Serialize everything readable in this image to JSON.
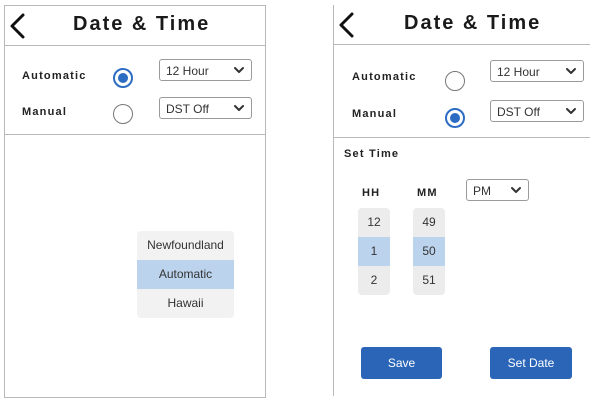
{
  "left_screen": {
    "title": "Date & Time",
    "automatic_label": "Automatic",
    "manual_label": "Manual",
    "automatic_selected": true,
    "manual_selected": false,
    "format_select": "12 Hour",
    "dst_select": "DST Off",
    "timezone_options": [
      "Newfoundland",
      "Automatic",
      "Hawaii"
    ],
    "timezone_selected": "Automatic"
  },
  "right_screen": {
    "title": "Date & Time",
    "automatic_label": "Automatic",
    "manual_label": "Manual",
    "automatic_selected": false,
    "manual_selected": true,
    "format_select": "12 Hour",
    "dst_select": "DST Off",
    "set_time_label": "Set Time",
    "hh_label": "HH",
    "mm_label": "MM",
    "ampm_select": "PM",
    "hours": [
      "12",
      "1",
      "2"
    ],
    "minutes": [
      "49",
      "50",
      "51"
    ],
    "save_label": "Save",
    "set_date_label": "Set Date"
  },
  "icons": {
    "back": "chevron-left-icon",
    "dropdown": "chevron-down-icon"
  },
  "colors": {
    "accent": "#2c6cc2",
    "button": "#2b65b8",
    "highlight": "#bcd3ee",
    "border": "#b9b9b9"
  }
}
